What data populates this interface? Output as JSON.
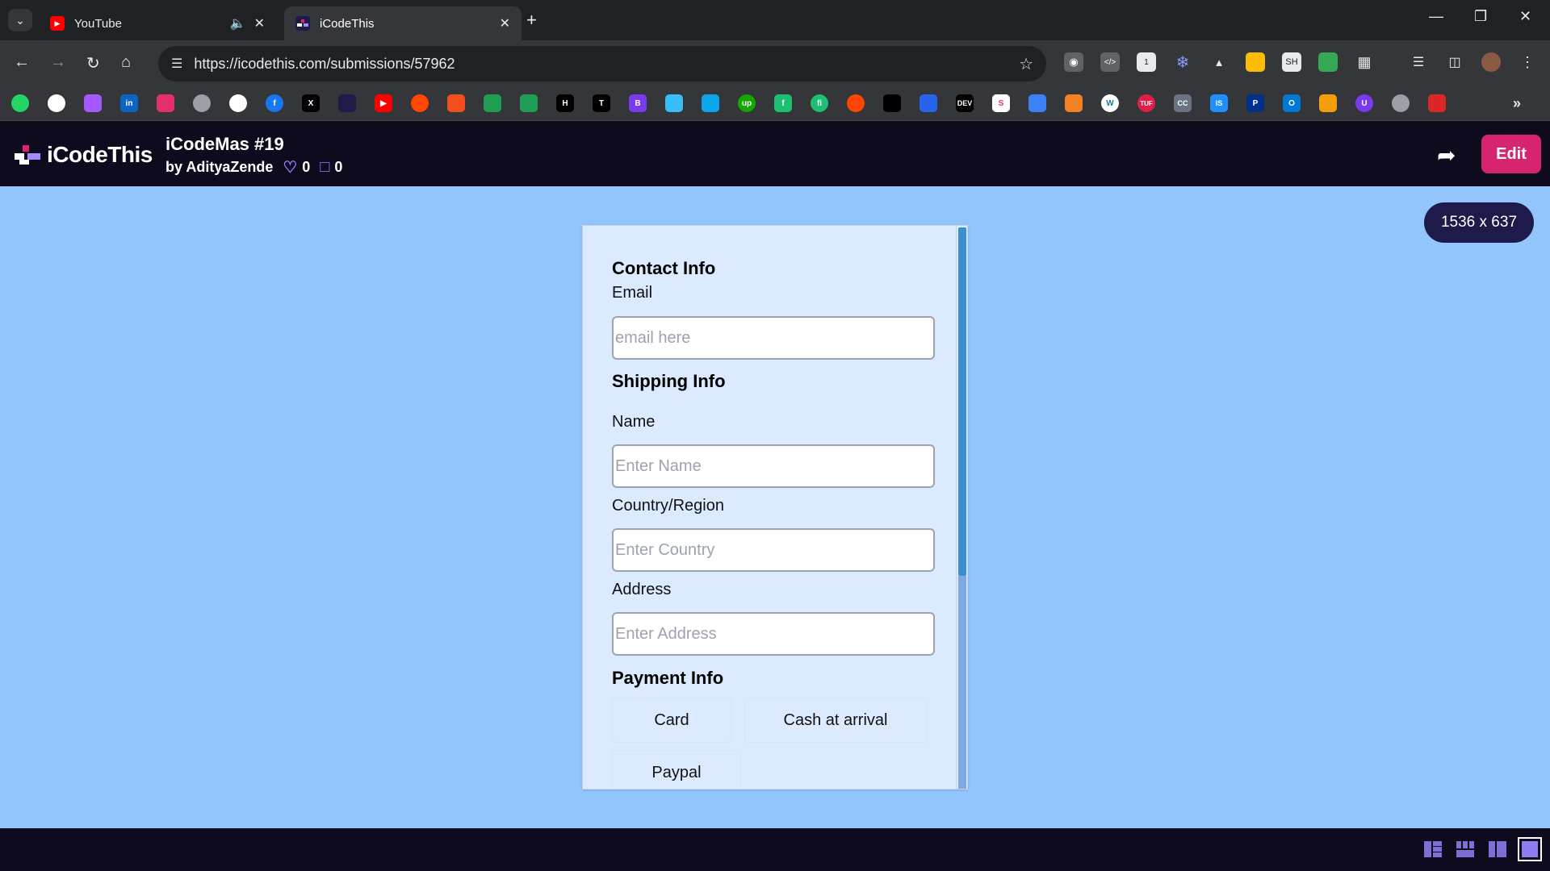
{
  "browser": {
    "tabs": [
      {
        "title": "YouTube",
        "favicon": "youtube-icon",
        "active": false
      },
      {
        "title": "iCodeThis",
        "favicon": "icodethis-icon",
        "active": true
      }
    ],
    "url": "https://icodethis.com/submissions/57962",
    "extension_badge": "1"
  },
  "header": {
    "logo_text": "iCodeThis",
    "submission_title": "iCodeMas #19",
    "author": "by AdityaZende",
    "likes": "0",
    "comments": "0",
    "edit_label": "Edit"
  },
  "canvas": {
    "size_badge": "1536 x 637",
    "background_color": "#93c5fd"
  },
  "form": {
    "contact": {
      "title": "Contact Info",
      "email_label": "Email",
      "email_placeholder": "email here"
    },
    "shipping": {
      "title": "Shipping Info",
      "name_label": "Name",
      "name_placeholder": "Enter Name",
      "country_label": "Country/Region",
      "country_placeholder": "Enter Country",
      "address_label": "Address",
      "address_placeholder": "Enter Address"
    },
    "payment": {
      "title": "Payment Info",
      "options": [
        "Card",
        "Cash at arrival",
        "Paypal"
      ]
    }
  },
  "colors": {
    "accent": "#d6246e",
    "header_bg": "#0f0b1e",
    "card_bg": "#dbeafe"
  }
}
